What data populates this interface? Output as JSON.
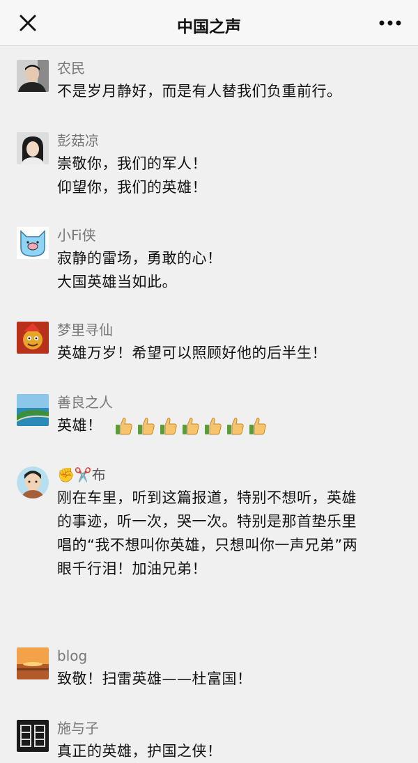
{
  "navbar": {
    "title": "中国之声",
    "close_icon": "close-icon",
    "more_icon": "more-icon"
  },
  "comments": [
    {
      "name": "农民",
      "lines": [
        "不是岁月静好，而是有人替我们负重前行。"
      ]
    },
    {
      "name": "彭菇凉",
      "lines": [
        "崇敬你，我们的军人！",
        "仰望你，我们的英雄！"
      ]
    },
    {
      "name": "小Fi侠",
      "lines": [
        "寂静的雷场，勇敢的心！",
        "大国英雄当如此。"
      ]
    },
    {
      "name": "梦里寻仙",
      "lines": [
        "英雄万岁！希望可以照顾好他的后半生！"
      ]
    },
    {
      "name": "善良之人",
      "lines": [
        "英雄！"
      ],
      "thumbs_up_count": 7
    },
    {
      "name": "✊✂️布",
      "lines": [
        "刚在车里，听到这篇报道，特别不想听，英雄",
        "的事迹，听一次，哭一次。特别是那首垫乐里",
        "唱的“我不想叫你英雄，只想叫你一声兄弟”两",
        "眼千行泪！加油兄弟！"
      ]
    },
    {
      "name": "blog",
      "lines": [
        "致敬！扫雷英雄——杜富国！"
      ]
    },
    {
      "name": "施与子",
      "lines": [
        "真正的英雄，护国之侠！"
      ]
    }
  ]
}
